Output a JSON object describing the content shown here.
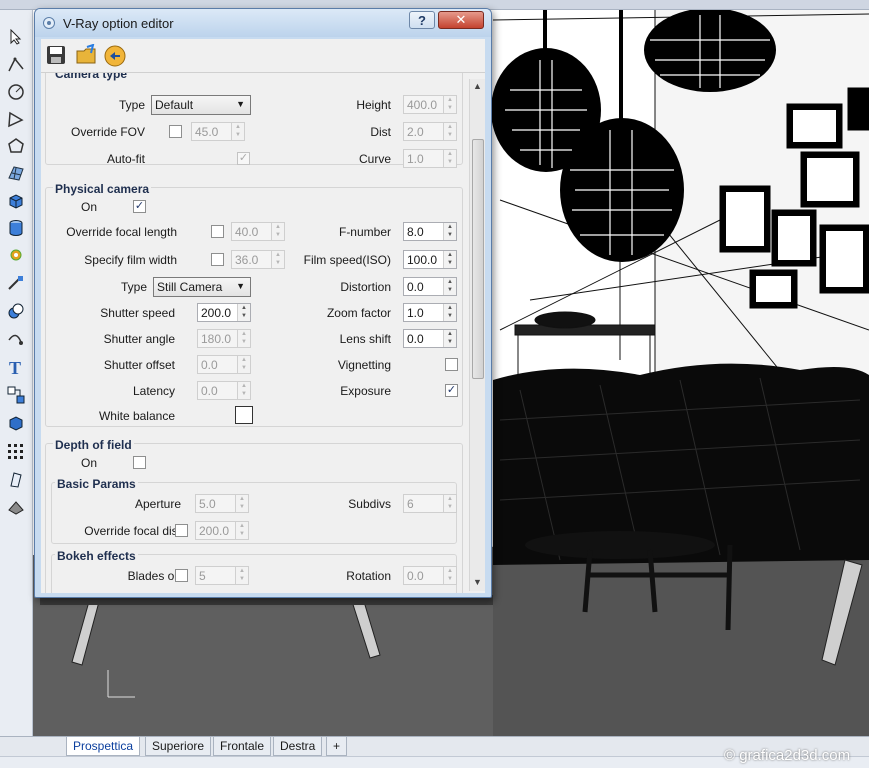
{
  "dialog": {
    "title": "V-Ray option editor",
    "help_label": "?",
    "close_label": "✕"
  },
  "camera_type": {
    "section_title": "Camera type",
    "type_label": "Type",
    "type_value": "Default",
    "height_label": "Height",
    "height_value": "400.0",
    "override_fov_label": "Override FOV",
    "fov_value": "45.0",
    "dist_label": "Dist",
    "dist_value": "2.0",
    "autofit_label": "Auto-fit",
    "curve_label": "Curve",
    "curve_value": "1.0"
  },
  "physical_camera": {
    "section_title": "Physical camera",
    "on_label": "On",
    "override_focal_label": "Override focal length",
    "focal_value": "40.0",
    "fnumber_label": "F-number",
    "fnumber_value": "8.0",
    "specify_film_label": "Specify film width",
    "film_value": "36.0",
    "filmspeed_label": "Film speed(ISO)",
    "filmspeed_value": "100.0",
    "type_label": "Type",
    "type_value": "Still Camera",
    "distortion_label": "Distortion",
    "distortion_value": "0.0",
    "shutter_speed_label": "Shutter speed",
    "shutter_speed_value": "200.0",
    "zoom_label": "Zoom factor",
    "zoom_value": "1.0",
    "shutter_angle_label": "Shutter angle",
    "shutter_angle_value": "180.0",
    "lens_shift_label": "Lens shift",
    "lens_shift_value": "0.0",
    "shutter_offset_label": "Shutter offset",
    "shutter_offset_value": "0.0",
    "vignetting_label": "Vignetting",
    "latency_label": "Latency",
    "latency_value": "0.0",
    "exposure_label": "Exposure",
    "white_balance_label": "White balance"
  },
  "depth_of_field": {
    "section_title": "Depth of field",
    "on_label": "On",
    "basic_title": "Basic Params",
    "aperture_label": "Aperture",
    "aperture_value": "5.0",
    "subdivs_label": "Subdivs",
    "subdivs_value": "6",
    "override_focal_dist_label": "Override focal dist",
    "focal_dist_value": "200.0",
    "bokeh_title": "Bokeh effects",
    "blades_label": "Blades on",
    "blades_value": "5",
    "rotation_label": "Rotation",
    "rotation_value": "0.0"
  },
  "tabs": [
    "Prospettica",
    "Superiore",
    "Frontale",
    "Destra",
    "+"
  ],
  "watermark": "© grafica2d3d.com",
  "colors": {
    "dialog_frame": "#c7dbf0",
    "active_tab_text": "#0b3f9e",
    "viewport_bg": "#5c5c5c"
  }
}
